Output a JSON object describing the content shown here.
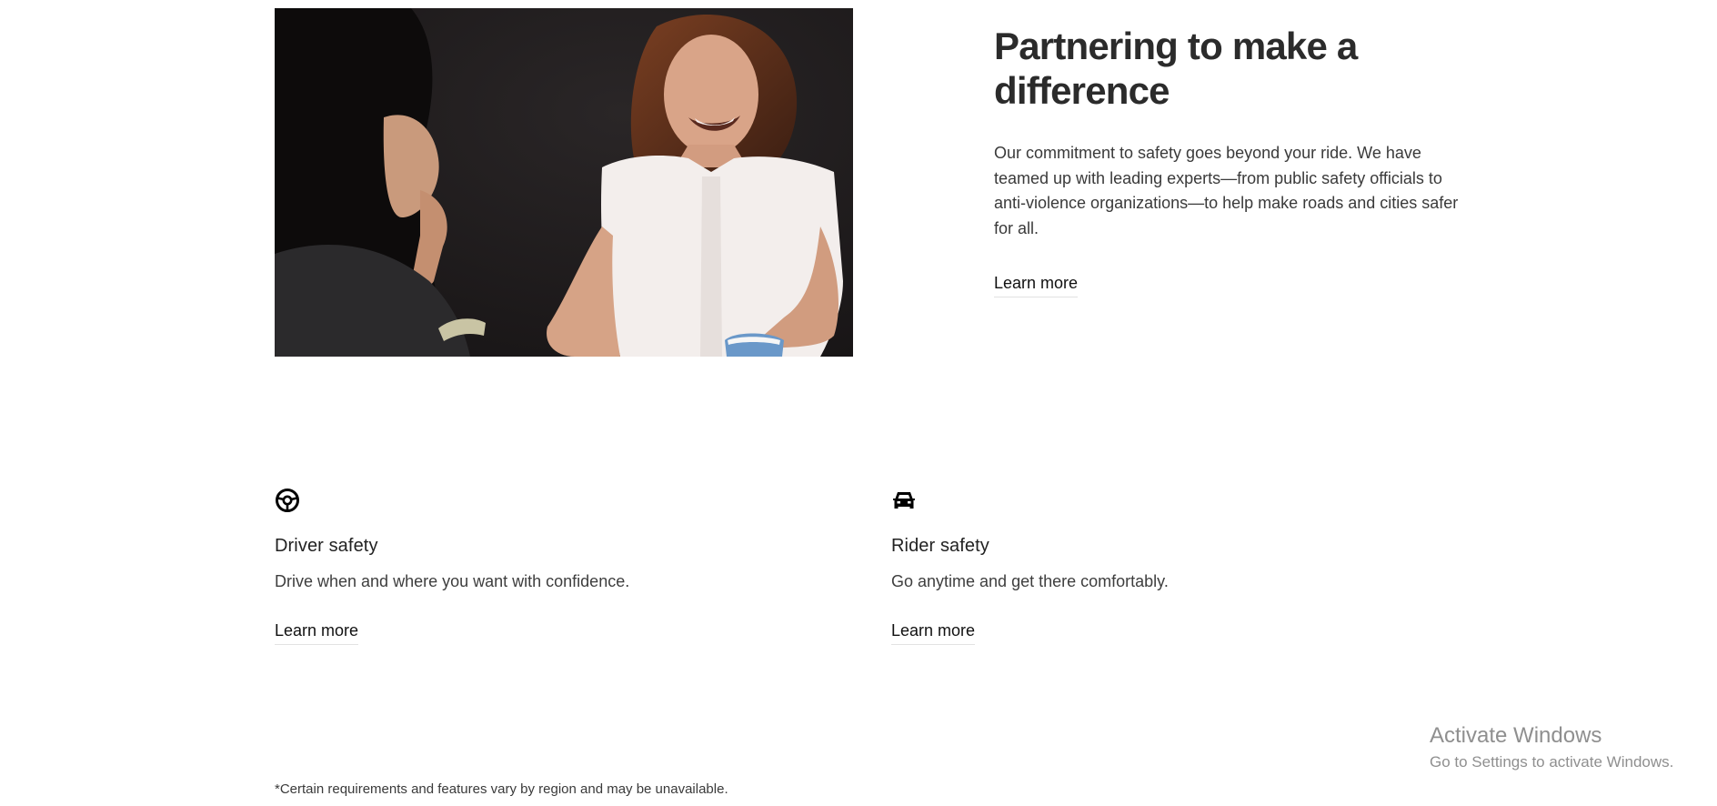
{
  "hero": {
    "image_alt": "Two women talking and laughing at a table"
  },
  "intro": {
    "heading": "Partnering to make a difference",
    "body": "Our commitment to safety goes beyond your ride. We have teamed up with leading experts—from public safety officials to anti-violence organizations—to help make roads and cities safer for all.",
    "link_label": "Learn more"
  },
  "cards": [
    {
      "icon": "steering-wheel-icon",
      "title": "Driver safety",
      "description": "Drive when and where you want with confidence.",
      "link_label": "Learn more"
    },
    {
      "icon": "car-icon",
      "title": "Rider safety",
      "description": "Go anytime and get there comfortably.",
      "link_label": "Learn more"
    }
  ],
  "footnote": "*Certain requirements and features vary by region and may be unavailable.",
  "watermark": {
    "title": "Activate Windows",
    "subtitle": "Go to Settings to activate Windows."
  },
  "colors": {
    "heading": "#2b2b2b",
    "body_text": "#3a3a3a",
    "link_underline": "#e2e2e2",
    "watermark": "#8f8f8f",
    "photo_background": "#1e1b1c"
  }
}
